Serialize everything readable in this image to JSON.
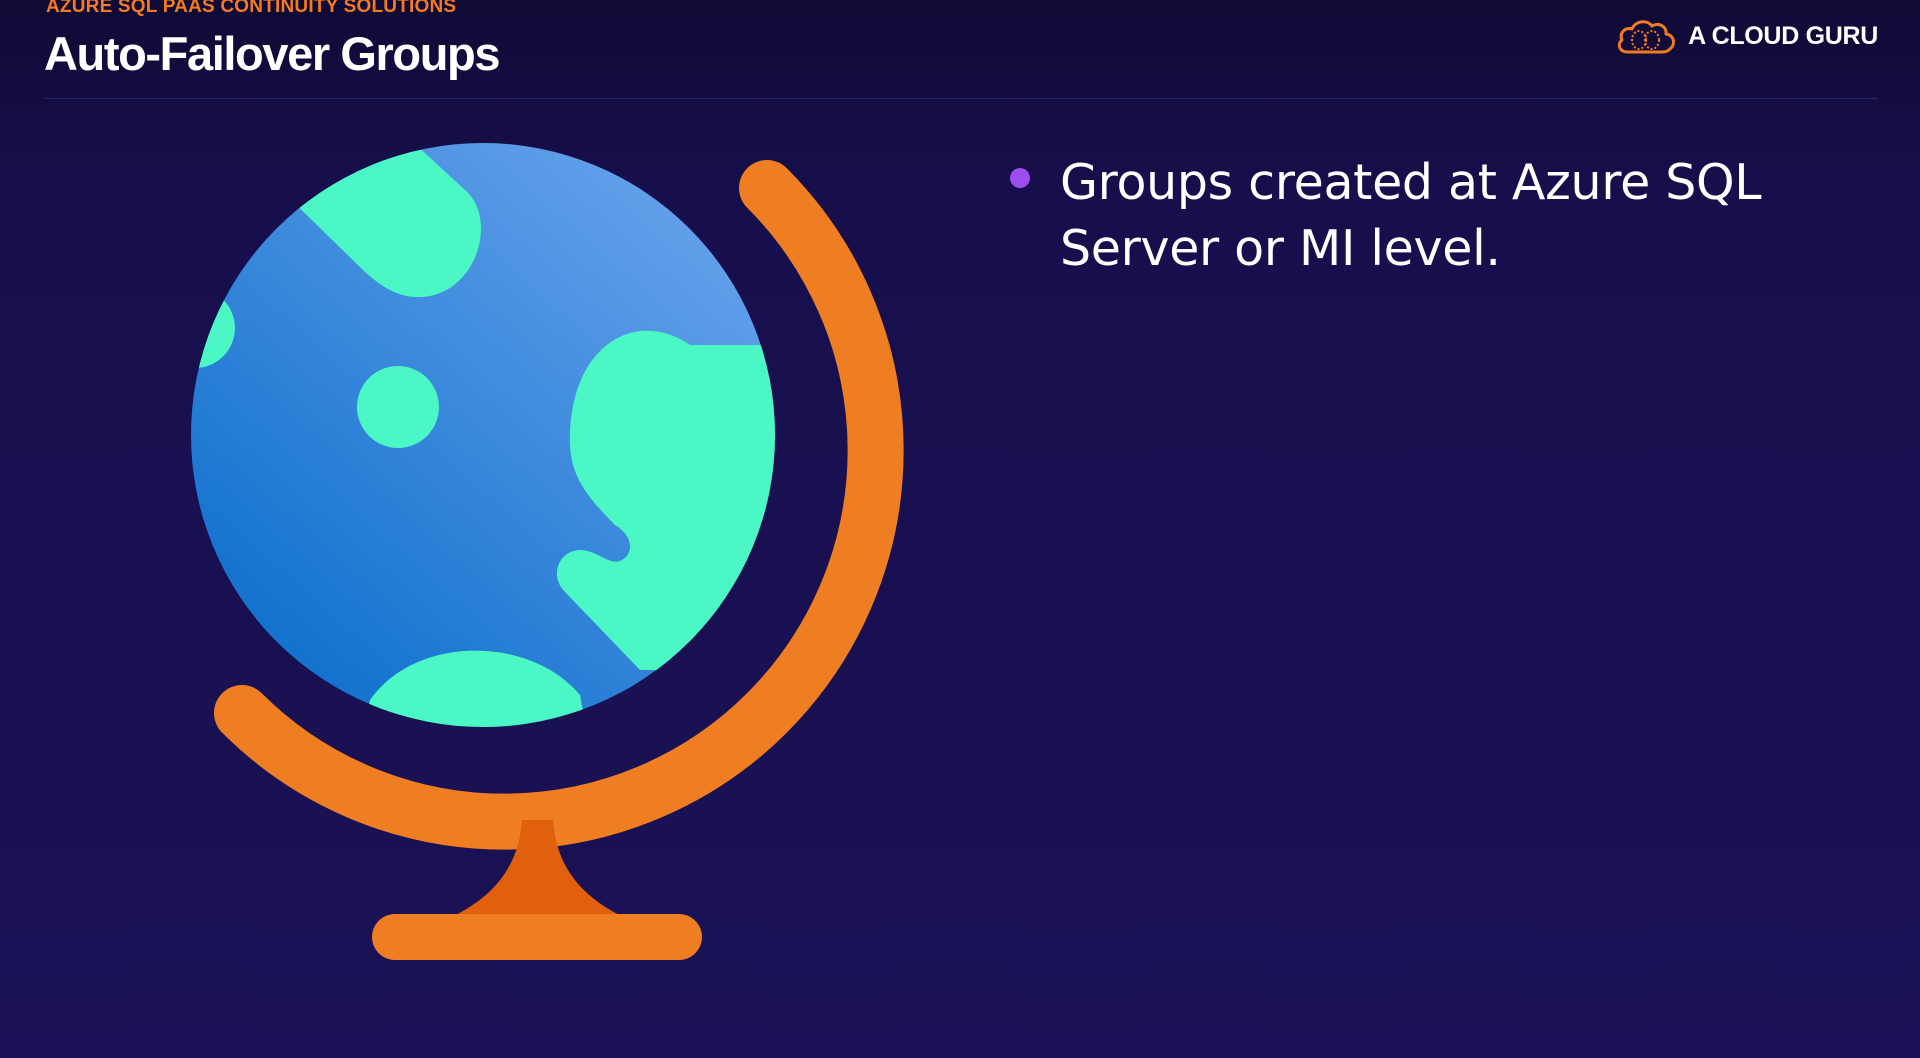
{
  "header": {
    "kicker": "AZURE SQL PAAS CONTINUITY SOLUTIONS",
    "title": "Auto-Failover Groups"
  },
  "brand": {
    "name": "A CLOUD GURU",
    "logo_icon": "cloud-brain-icon",
    "logo_color": "#f47b20"
  },
  "illustration": {
    "icon": "globe-icon",
    "ocean_color": "#4a8fe0",
    "land_color": "#4cf7c6",
    "stand_color": "#ef7d21"
  },
  "bullets": [
    {
      "text": "Groups created at Azure SQL Server or MI level."
    }
  ],
  "colors": {
    "background": "#1b1257",
    "accent_orange": "#f47b20",
    "bullet_purple": "#9b4dee"
  }
}
